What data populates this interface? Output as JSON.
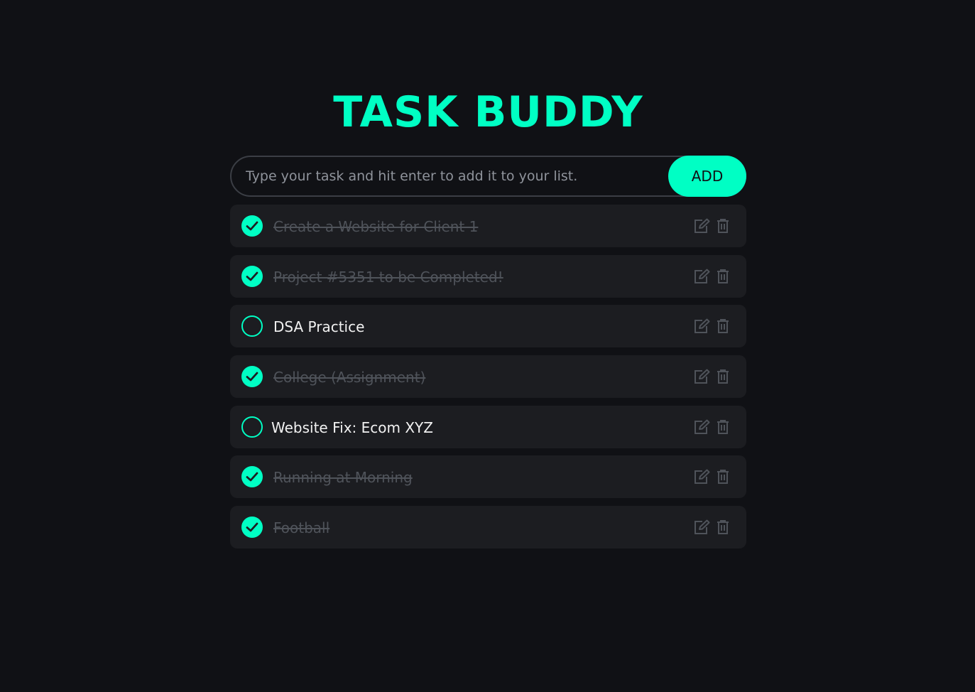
{
  "app": {
    "title": "TASK BUDDY"
  },
  "input": {
    "placeholder": "Type your task and hit enter to add it to your list.",
    "value": ""
  },
  "add_button": {
    "label": "ADD"
  },
  "tasks": [
    {
      "text": "Create a Website for Client 1",
      "completed": true
    },
    {
      "text": "Project #5351 to be Completed!",
      "completed": true
    },
    {
      "text": "DSA Practice",
      "completed": false
    },
    {
      "text": "College (Assignment)",
      "completed": true
    },
    {
      "text": "Website Fix: Ecom XYZ",
      "completed": false
    },
    {
      "text": "Running at Morning",
      "completed": true
    },
    {
      "text": "Football",
      "completed": true
    }
  ],
  "icons": {
    "completed": "check-circle-icon",
    "pending": "circle-icon",
    "edit": "edit-icon",
    "delete": "trash-icon"
  },
  "colors": {
    "accent": "#00ffc4",
    "background": "#101115",
    "card": "#1c1d21",
    "muted_text": "#4f535a",
    "text": "#f1f1f1"
  }
}
